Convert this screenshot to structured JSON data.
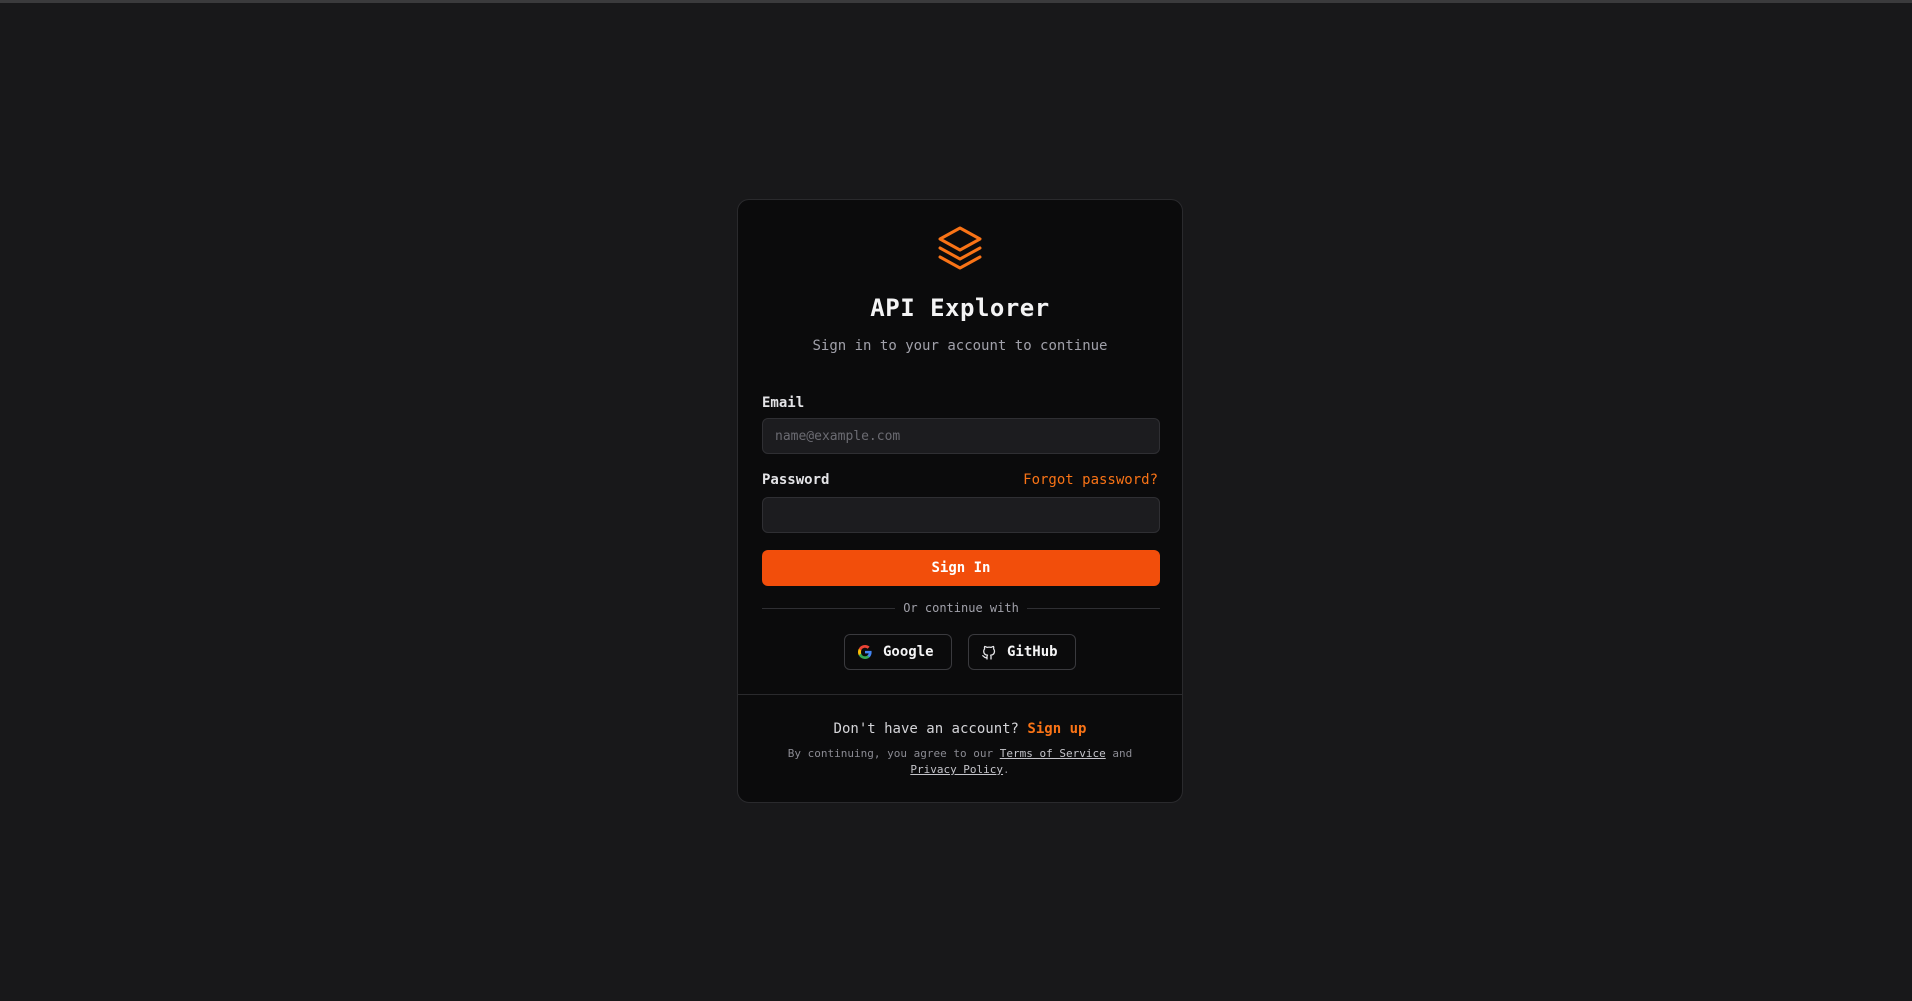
{
  "app": {
    "title": "API Explorer",
    "subtitle": "Sign in to your account to continue",
    "logo_icon": "layers-icon"
  },
  "form": {
    "email_label": "Email",
    "email_placeholder": "name@example.com",
    "email_value": "",
    "password_label": "Password",
    "password_value": "",
    "forgot_label": "Forgot password?",
    "submit_label": "Sign In"
  },
  "divider": {
    "text": "Or continue with"
  },
  "social": [
    {
      "label": "Google",
      "icon": "google-icon"
    },
    {
      "label": "GitHub",
      "icon": "github-icon"
    }
  ],
  "footer": {
    "question": "Don't have an account?",
    "signup_label": "Sign up",
    "legal_prefix": "By continuing, you agree to our",
    "terms_label": "Terms of Service",
    "legal_and": "and",
    "privacy_label": "Privacy Policy",
    "legal_suffix": "."
  },
  "colors": {
    "background": "#18181a",
    "card": "#0b0b0c",
    "accent": "#f24e0b",
    "accent_text": "#f97316"
  }
}
